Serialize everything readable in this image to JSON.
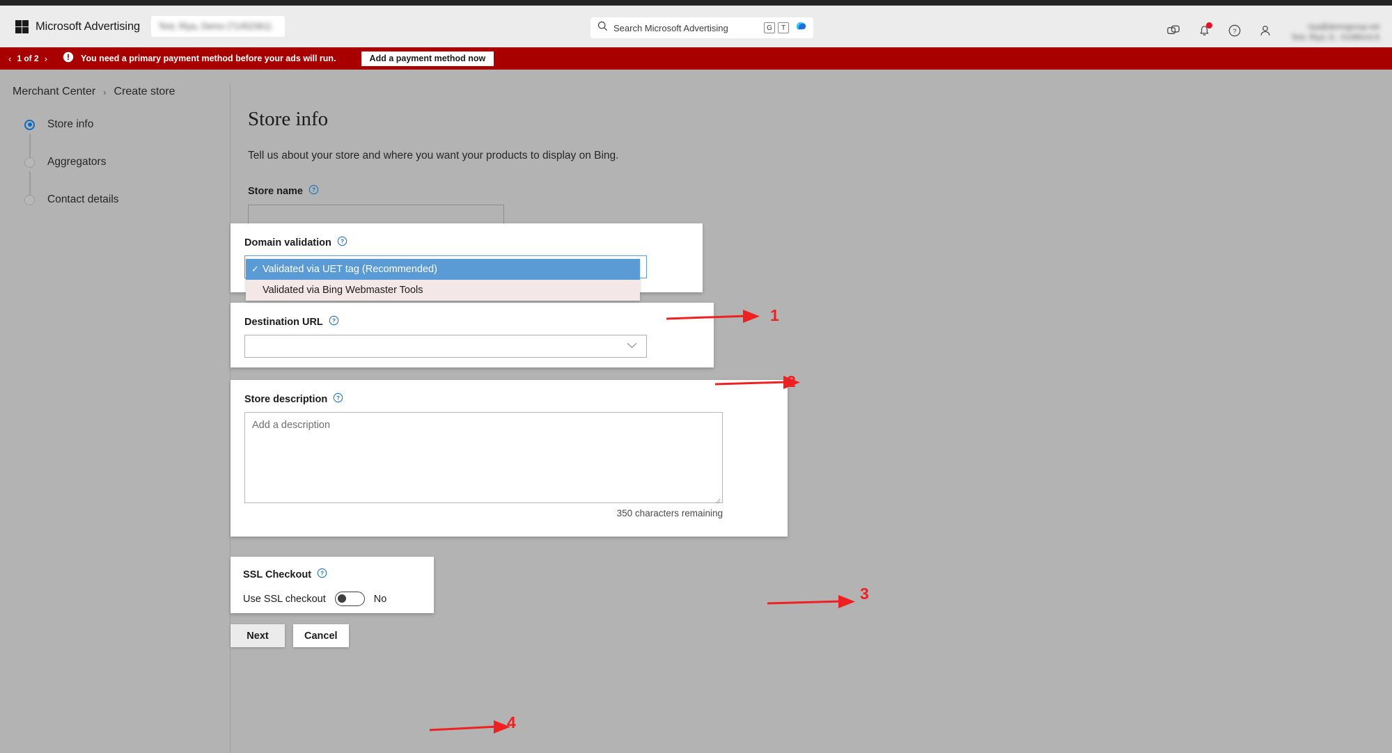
{
  "header": {
    "brand": "Microsoft Advertising",
    "account_selector": "Test, Riya, Demo (71452361)",
    "search": {
      "placeholder": "Search Microsoft Advertising",
      "badge_g": "G",
      "badge_t": "T"
    },
    "icons": {
      "tools": "tools-icon",
      "notifications": "bell-icon",
      "help": "help-circle-icon",
      "account": "person-icon",
      "copilot": "copilot-icon"
    },
    "user_email": "riya@demogroup.net",
    "user_name": "Test, Riya, D..  #1086nnt-8"
  },
  "alert": {
    "pager": "1 of 2",
    "prev": "‹",
    "next": "›",
    "message": "You need a primary payment method before your ads will run.",
    "button": "Add a payment method now"
  },
  "breadcrumb": {
    "root": "Merchant Center",
    "separator": "›",
    "current": "Create store"
  },
  "stepper": {
    "items": [
      {
        "label": "Store info",
        "active": true
      },
      {
        "label": "Aggregators",
        "active": false
      },
      {
        "label": "Contact details",
        "active": false
      }
    ]
  },
  "main": {
    "title": "Store info",
    "subtitle": "Tell us about your store and where you want your products to display on Bing.",
    "store_name": {
      "label": "Store name",
      "value": "",
      "placeholder": ""
    },
    "domain_validation": {
      "label": "Domain validation",
      "selected": "Validated via UET tag (Recommended)",
      "check_glyph": "✓",
      "options": [
        "Validated via UET tag (Recommended)",
        "Validated via Bing Webmaster Tools"
      ]
    },
    "destination_url": {
      "label": "Destination URL",
      "value": ""
    },
    "store_description": {
      "label": "Store description",
      "placeholder": "Add a description",
      "value": "",
      "counter": "350 characters remaining"
    },
    "ssl_checkout": {
      "label": "SSL Checkout",
      "toggle_label": "Use SSL checkout",
      "state": "No",
      "enabled": false
    },
    "buttons": {
      "next": "Next",
      "cancel": "Cancel"
    }
  },
  "annotations": [
    {
      "number": "1"
    },
    {
      "number": "2"
    },
    {
      "number": "3"
    },
    {
      "number": "4"
    }
  ],
  "colors": {
    "alert_red": "#a80000",
    "annotation_red": "#ef2020",
    "accent_blue": "#0d6abf",
    "select_highlight": "#5b9bd5",
    "page_bg": "#b3b3b3"
  }
}
